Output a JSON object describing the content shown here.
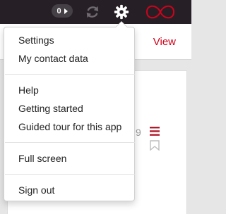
{
  "topbar": {
    "badge_count": "0",
    "icons": [
      "play-icon",
      "sync-icon",
      "gear-icon",
      "infinity-logo"
    ]
  },
  "header": {
    "view_label": "View"
  },
  "card": {
    "number": "9",
    "icons": [
      "menu-lines-icon",
      "bookmark-icon"
    ]
  },
  "menu": {
    "settings": "Settings",
    "contact": "My contact data",
    "help": "Help",
    "getting_started": "Getting started",
    "guided_tour": "Guided tour for this app",
    "full_screen": "Full screen",
    "sign_out": "Sign out"
  },
  "colors": {
    "topbar": "#262026",
    "accent_red": "#d0021b",
    "menu_text": "#222222"
  }
}
